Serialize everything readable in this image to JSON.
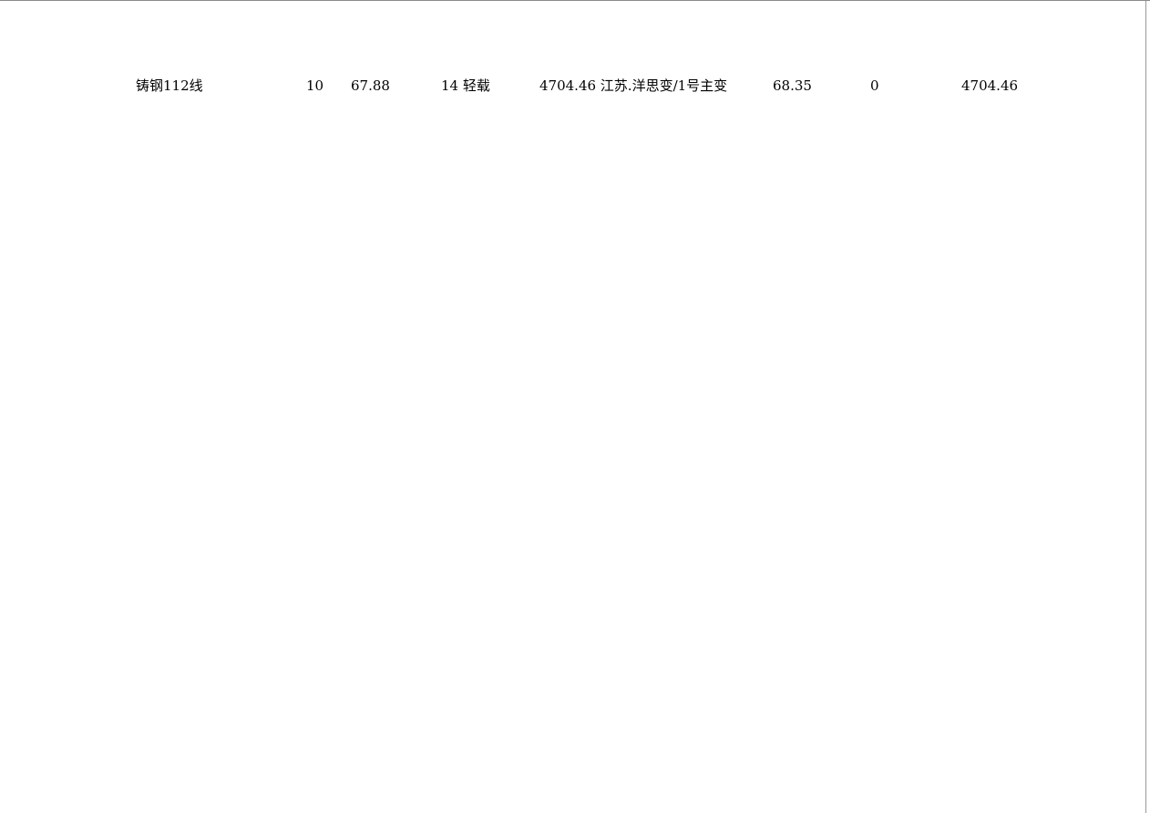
{
  "table": {
    "row": {
      "name": "铸钢112线",
      "col2": "10",
      "col3": "67.88",
      "col4": "14 轻载",
      "col5": "4704.46 江苏.洋思变/1号主变",
      "col6": "68.35",
      "col7": "0",
      "col8": "4704.46"
    }
  }
}
